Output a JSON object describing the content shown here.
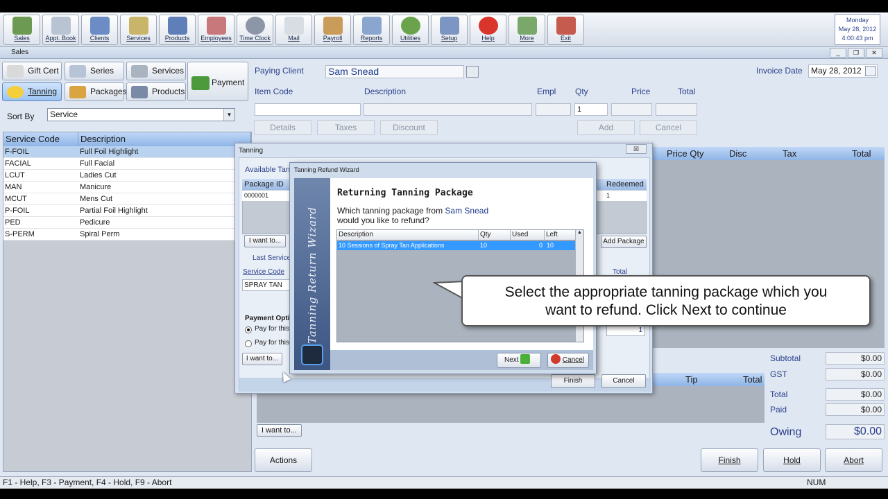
{
  "toolbar": {
    "buttons": [
      "Sales",
      "Appt. Book",
      "Clients",
      "Services",
      "Products",
      "Employees",
      "Time Clock",
      "Mail",
      "Payroll",
      "Reports",
      "Utilities",
      "Setup",
      "Help",
      "More",
      "Exit"
    ],
    "date": {
      "day": "Monday",
      "date": "May 28, 2012",
      "time": "4:00:43 pm"
    }
  },
  "window": {
    "title": "Sales"
  },
  "categories": {
    "gift_cert": "Gift Cert",
    "series": "Series",
    "services": "Services",
    "payment": "Payment",
    "tanning": "Tanning",
    "packages": "Packages",
    "products": "Products"
  },
  "sort": {
    "label": "Sort By",
    "value": "Service"
  },
  "service_table": {
    "headers": [
      "Service Code",
      "Description"
    ],
    "rows": [
      {
        "code": "F-FOIL",
        "desc": "Full Foil Highlight"
      },
      {
        "code": "FACIAL",
        "desc": "Full Facial"
      },
      {
        "code": "LCUT",
        "desc": "Ladies Cut"
      },
      {
        "code": "MAN",
        "desc": "Manicure"
      },
      {
        "code": "MCUT",
        "desc": "Mens Cut"
      },
      {
        "code": "P-FOIL",
        "desc": "Partial Foil Highlight"
      },
      {
        "code": "PED",
        "desc": "Pedicure"
      },
      {
        "code": "S-PERM",
        "desc": "Spiral Perm"
      }
    ]
  },
  "invoice": {
    "paying_client_label": "Paying Client",
    "paying_client": "Sam Snead",
    "invoice_date_label": "Invoice Date",
    "invoice_date": "May 28, 2012",
    "item_headers": {
      "item_code": "Item Code",
      "description": "Description",
      "empl": "Empl",
      "qty": "Qty",
      "price": "Price",
      "total": "Total"
    },
    "qty_value": "1",
    "buttons": {
      "details": "Details",
      "taxes": "Taxes",
      "discount": "Discount",
      "add": "Add",
      "cancel": "Cancel"
    },
    "grid_headers": {
      "price_qty": "Price Qty",
      "disc": "Disc",
      "tax": "Tax",
      "total": "Total"
    },
    "tip_headers": {
      "tip": "Tip",
      "total": "Total"
    },
    "i_want_to": "I want to...",
    "summary": {
      "subtotal_label": "Subtotal",
      "subtotal": "$0.00",
      "gst_label": "GST",
      "gst": "$0.00",
      "total_label": "Total",
      "total": "$0.00",
      "paid_label": "Paid",
      "paid": "$0.00",
      "owing_label": "Owing",
      "owing": "$0.00"
    },
    "bottom_buttons": {
      "actions": "Actions",
      "finish": "Finish",
      "hold": "Hold",
      "abort": "Abort"
    }
  },
  "tanning_dialog": {
    "title": "Tanning",
    "close": "☒",
    "available_label": "Available Tann",
    "headers": {
      "package_id": "Package ID",
      "redeemed": "Redeemed"
    },
    "row": {
      "package_id": "0000001",
      "redeemed": "1"
    },
    "i_want_to": "I want to...",
    "add_package": "Add Package",
    "last_service": "Last Service",
    "service_code_label": "Service Code",
    "service_code": "SPRAY TAN",
    "total_label": "Total",
    "payment_option": "Payment Optio",
    "pay_option_1": "Pay for this",
    "pay_option_2": "Pay for this",
    "i_want_to_2": "I want to...",
    "field_value": "1",
    "finish": "Finish",
    "cancel": "Cancel"
  },
  "wizard": {
    "title": "Tanning Refund Wizard",
    "side_text": "Tanning Return Wizard",
    "heading": "Returning Tanning Package",
    "question_pre": "Which tanning package from ",
    "client": "Sam Snead",
    "question_post": "would you like to refund?",
    "headers": {
      "description": "Description",
      "qty": "Qty",
      "used": "Used",
      "left": "Left"
    },
    "row": {
      "description": "10 Sessions of Spray Tan Applications",
      "qty": "10",
      "used": "0",
      "left": "10"
    },
    "next": "Next",
    "cancel": "Cancel"
  },
  "callout": {
    "line1": "Select the appropriate tanning package which you",
    "line2": "want to refund. Click Next to continue"
  },
  "status": {
    "help": "F1 - Help, F3 - Payment, F4 - Hold, F9 - Abort",
    "num": "NUM"
  },
  "colors": {
    "accent": "#2a3f8a",
    "selection": "#3399ff",
    "header_blue": "#8fb5e6"
  }
}
